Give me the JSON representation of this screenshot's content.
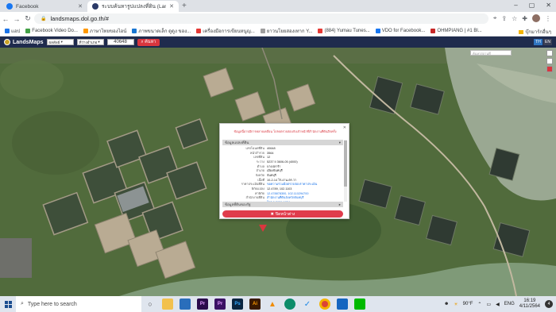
{
  "browser": {
    "tabs": [
      {
        "title": "Facebook",
        "active": false
      },
      {
        "title": "ระบบค้นหารูปแปลงที่ดิน (LandsMaps)",
        "active": true
      }
    ],
    "url": "landsmaps.dol.go.th/#",
    "window_controls": [
      "–",
      "▢",
      "✕"
    ]
  },
  "bookmarks": {
    "items": [
      {
        "label": "แอป",
        "color": "#1a73e8"
      },
      {
        "label": "Facebook Video Do...",
        "color": "#43a047"
      },
      {
        "label": "ภาษาไทยของไอน์",
        "color": "#ff9800"
      },
      {
        "label": "ภาพขนาดเล็ก ดูดูง ของ...",
        "color": "#1976d2"
      },
      {
        "label": "เครื่องมือการเขียนหนูญ...",
        "color": "#e53935"
      },
      {
        "label": "ยาวนโยยสองเทาก Y...",
        "color": "#9e9e9e"
      },
      {
        "label": "(884) Yumau Tunes...",
        "color": "#e53935"
      },
      {
        "label": "VDO for Facebook...",
        "color": "#1877f2"
      },
      {
        "label": "OHMPIANG | #1 Bl...",
        "color": "#c62828"
      }
    ],
    "reading_list": "บุ๊กมาร์กอื่นๆ"
  },
  "app": {
    "name": "LandsMaps",
    "province_select": "ผลลัพธ์",
    "district_select": "ที่ว่างอำเภอ",
    "parcel_input": "40648",
    "search_button": "ค้นหา",
    "lang_th": "TH",
    "lang_en": "EN",
    "map_search_placeholder": "ค้นหาสถานที่"
  },
  "popup": {
    "warning": "ข้อมูลนี้อาจมีการคลาดเคลื่อน โปรดตรวจสอบกับเจ้าหน้าที่สำนักงานที่ดินอีกครั้ง",
    "section1": "ข้อมูลแปลงที่ดิน",
    "section2": "ข้อมูลที่ดินของรัฐ",
    "toggle_open": "▾",
    "toggle_closed": "▸",
    "rows": [
      {
        "k": "เลขโฉนดที่ดิน",
        "v": "40648",
        "link": false
      },
      {
        "k": "หน้าสำรวจ",
        "v": "3564",
        "link": false
      },
      {
        "k": "เลขที่ดิน",
        "v": "12",
        "link": false
      },
      {
        "k": "ระวาง",
        "v": "5237 II 3606-05 (4000)",
        "link": false
      },
      {
        "k": "ตำบล",
        "v": "บางปลาร้า",
        "link": false
      },
      {
        "k": "อำเภอ",
        "v": "เมืองจันทบุรี",
        "link": false
      },
      {
        "k": "จังหวัด",
        "v": "จันทบุรี",
        "link": false
      },
      {
        "k": "เนื้อที่",
        "v": "10-2-14 ไร่-งาน-ตร.วา",
        "link": false
      },
      {
        "k": "ราคาประเมินที่ดิน",
        "v": "ขอความร่วมมือตรวจสอบราคาประเมิน",
        "link": true
      },
      {
        "k": "พิกัดแปลง",
        "v": "12.4789, 102.1103",
        "link": false
      },
      {
        "k": "ค่าพิกัด",
        "v": "12.478878300, 102.110294700",
        "link": true
      },
      {
        "k": "สำนักงานที่ดิน",
        "v": "สำนักงานที่ดินจังหวัดจันทบุรี",
        "link": true
      },
      {
        "k": "",
        "v": "โทร 0-3931-1234",
        "link": true
      }
    ],
    "close_label": "ปิดหน้าต่าง",
    "close_icon": "✖"
  },
  "taskbar": {
    "search_placeholder": "Type here to search",
    "apps": [
      {
        "name": "task-view",
        "label": "○",
        "color": "#444"
      },
      {
        "name": "file-explorer",
        "label": "",
        "color": "#f2c14e"
      },
      {
        "name": "mail",
        "label": "",
        "color": "#2a6ebb"
      },
      {
        "name": "premiere",
        "label": "Pr",
        "color": "#2a0a4a"
      },
      {
        "name": "premiere-2",
        "label": "Pr",
        "color": "#3b1264"
      },
      {
        "name": "photoshop",
        "label": "Ps",
        "color": "#0a2540"
      },
      {
        "name": "illustrator",
        "label": "Ai",
        "color": "#3a1a00"
      },
      {
        "name": "vlc",
        "label": "▲",
        "color": "#f08c00"
      },
      {
        "name": "edge",
        "label": "",
        "color": "#0c8c6a"
      },
      {
        "name": "check-app",
        "label": "✓",
        "color": "#1e88e5"
      },
      {
        "name": "chrome",
        "label": "",
        "color": "#db4437"
      },
      {
        "name": "photos",
        "label": "",
        "color": "#1565c0"
      },
      {
        "name": "line",
        "label": "",
        "color": "#00b900"
      }
    ],
    "weather": "90°F",
    "lang": "ENG",
    "time": "16:19",
    "date": "4/11/2564",
    "notification_count": "4"
  }
}
